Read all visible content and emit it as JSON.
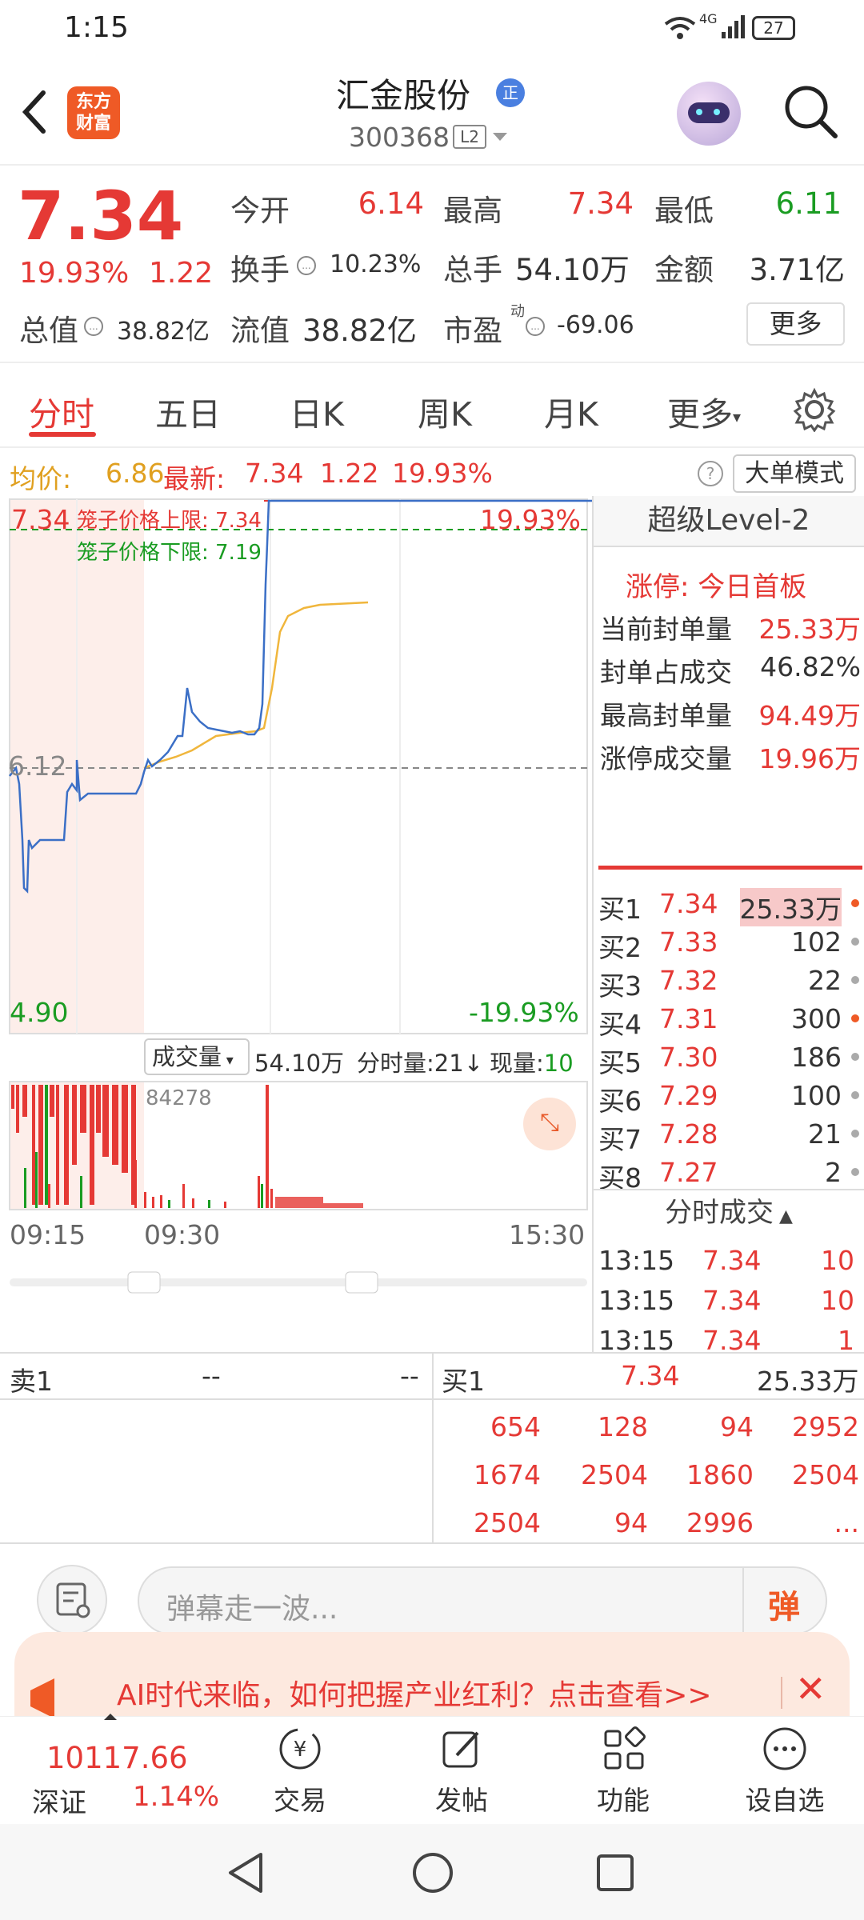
{
  "status": {
    "time": "1:15",
    "battery": "27",
    "net": "4G"
  },
  "header": {
    "logo_line1": "东方",
    "logo_line2": "财富",
    "title": "汇金股份",
    "title_badge": "正",
    "code": "300368",
    "level_badge": "L2"
  },
  "quote": {
    "price": "7.34",
    "change_pct": "19.93%",
    "change": "1.22",
    "open_label": "今开",
    "open": "6.14",
    "high_label": "最高",
    "high": "7.34",
    "low_label": "最低",
    "low": "6.11",
    "turnover_label": "换手",
    "turnover": "10.23%",
    "volume_label": "总手",
    "volume": "54.10万",
    "amount_label": "金额",
    "amount": "3.71亿",
    "mktcap_label": "总值",
    "mktcap": "38.82亿",
    "float_label": "流值",
    "float": "38.82亿",
    "pe_label": "市盈",
    "pe_sup": "动",
    "pe": "-69.06",
    "more": "更多"
  },
  "tabs": [
    "分时",
    "五日",
    "日K",
    "周K",
    "月K",
    "更多"
  ],
  "infobar": {
    "avg_label": "均价:",
    "avg": "6.86",
    "latest_label": "最新:",
    "latest": "7.34",
    "chg": "1.22",
    "pct": "19.93%",
    "mode": "大单模式"
  },
  "chart": {
    "top_price": "7.34",
    "top_pct": "19.93%",
    "upper_limit": "笼子价格上限: 7.34",
    "lower_limit": "笼子价格下限: 7.19",
    "mid_price": "6.12",
    "bottom_price": "4.90",
    "bottom_pct": "-19.93%",
    "vol_label": "成交量",
    "vol_total": "54.10万",
    "tick_label": "分时量:21",
    "now_label": "现量:",
    "now": "10",
    "vol_max": "84278",
    "time_start": "09:15",
    "time_open": "09:30",
    "time_end": "15:30"
  },
  "right": {
    "title": "超级Level-2",
    "limit_label": "涨停: 今日首板",
    "stats": [
      {
        "label": "当前封单量",
        "value": "25.33万"
      },
      {
        "label": "封单占成交",
        "value": "46.82%"
      },
      {
        "label": "最高封单量",
        "value": "94.49万"
      },
      {
        "label": "涨停成交量",
        "value": "19.96万"
      }
    ],
    "bids": [
      {
        "label": "买1",
        "price": "7.34",
        "vol": "25.33万"
      },
      {
        "label": "买2",
        "price": "7.33",
        "vol": "102"
      },
      {
        "label": "买3",
        "price": "7.32",
        "vol": "22"
      },
      {
        "label": "买4",
        "price": "7.31",
        "vol": "300"
      },
      {
        "label": "买5",
        "price": "7.30",
        "vol": "186"
      },
      {
        "label": "买6",
        "price": "7.29",
        "vol": "100"
      },
      {
        "label": "买7",
        "price": "7.28",
        "vol": "21"
      },
      {
        "label": "买8",
        "price": "7.27",
        "vol": "2"
      }
    ],
    "trades_title": "分时成交",
    "trades": [
      {
        "time": "13:15",
        "price": "7.34",
        "vol": "10"
      },
      {
        "time": "13:15",
        "price": "7.34",
        "vol": "10"
      },
      {
        "time": "13:15",
        "price": "7.34",
        "vol": "1"
      }
    ]
  },
  "book": {
    "sell_label": "卖1",
    "sell_price": "--",
    "sell_vol": "--",
    "buy_label": "买1",
    "buy_price": "7.34",
    "buy_vol": "25.33万",
    "queue": [
      [
        "654",
        "128",
        "94",
        "2952"
      ],
      [
        "1674",
        "2504",
        "1860",
        "2504"
      ],
      [
        "2504",
        "94",
        "2996",
        "..."
      ]
    ]
  },
  "comment": {
    "placeholder": "弹幕走一波...",
    "danmu": "弹"
  },
  "banner": {
    "text": "AI时代来临，如何把握产业红利？点击查看>>"
  },
  "nav": {
    "index_value": "10117.66",
    "index_name": "深证",
    "index_pct": "1.14%",
    "items": [
      "交易",
      "发帖",
      "功能",
      "设自选"
    ]
  }
}
